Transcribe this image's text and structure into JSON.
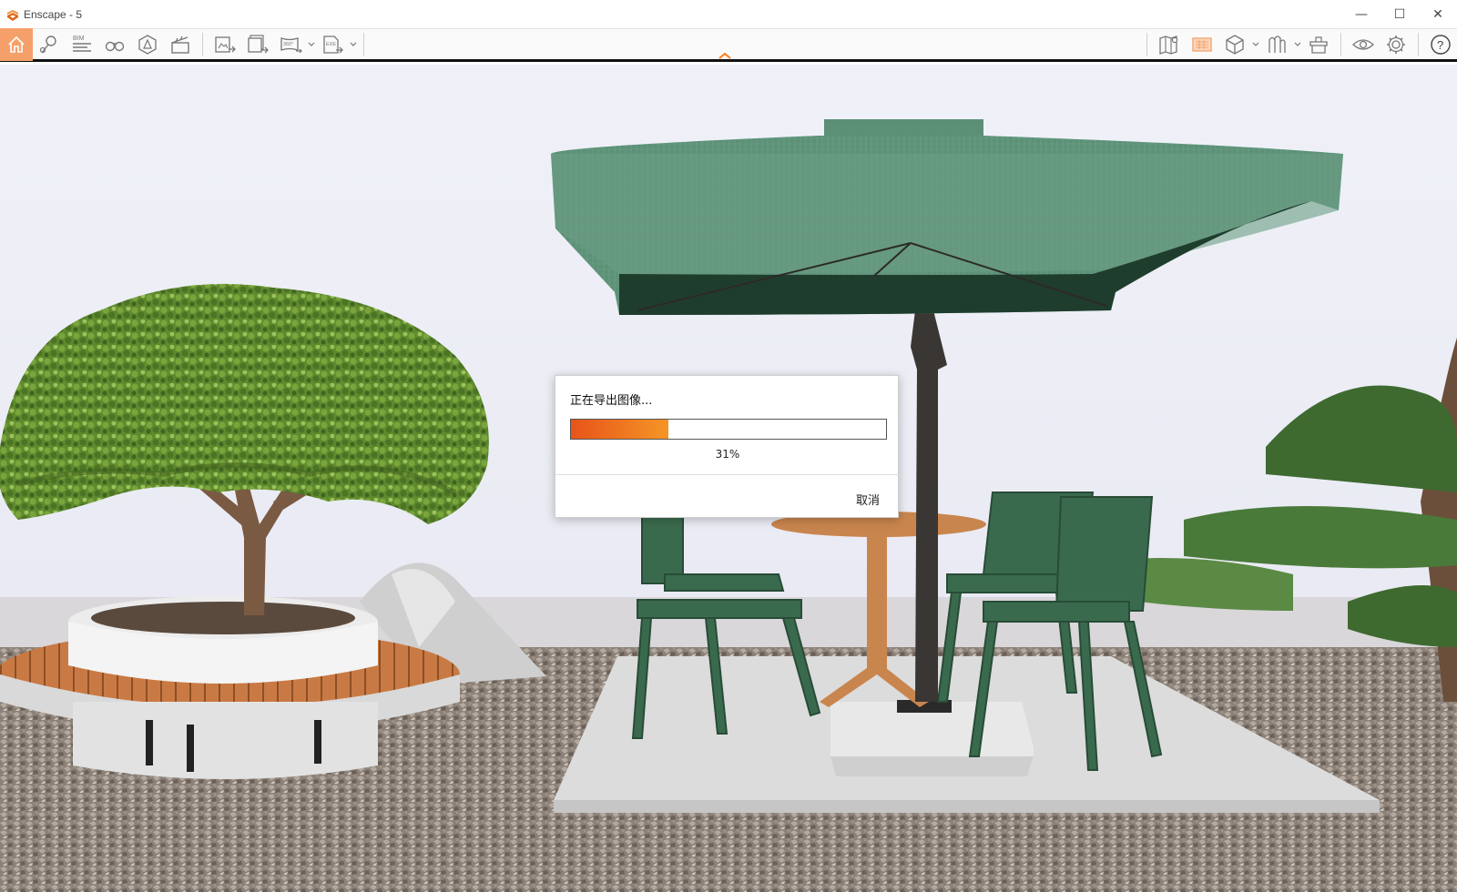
{
  "window": {
    "title": "Enscape - 5",
    "controls": {
      "minimize": "—",
      "maximize": "☐",
      "close": "✕"
    }
  },
  "toolbar": {
    "left_icons": [
      "home-icon",
      "navigation-pin-icon",
      "bim-icon",
      "binoculars-icon",
      "perspective-icon",
      "clapper-icon",
      "export-image-icon",
      "batch-export-icon",
      "panorama-360-icon",
      "export-exe-icon"
    ],
    "bim_label": "BIM",
    "pano_label": "360°",
    "exe_label": "EXE",
    "right_icons": [
      "map-icon",
      "atlas-icon",
      "cube-icon",
      "asset-library-icon",
      "upload-icon",
      "eye-icon",
      "gear-icon",
      "help-icon"
    ],
    "help_label": "?",
    "active_color": "#f5a06a",
    "accent_color": "#ff7a1a"
  },
  "dialog": {
    "title": "正在导出图像...",
    "progress": 0.31,
    "percent_label": "31%",
    "cancel_label": "取消"
  }
}
